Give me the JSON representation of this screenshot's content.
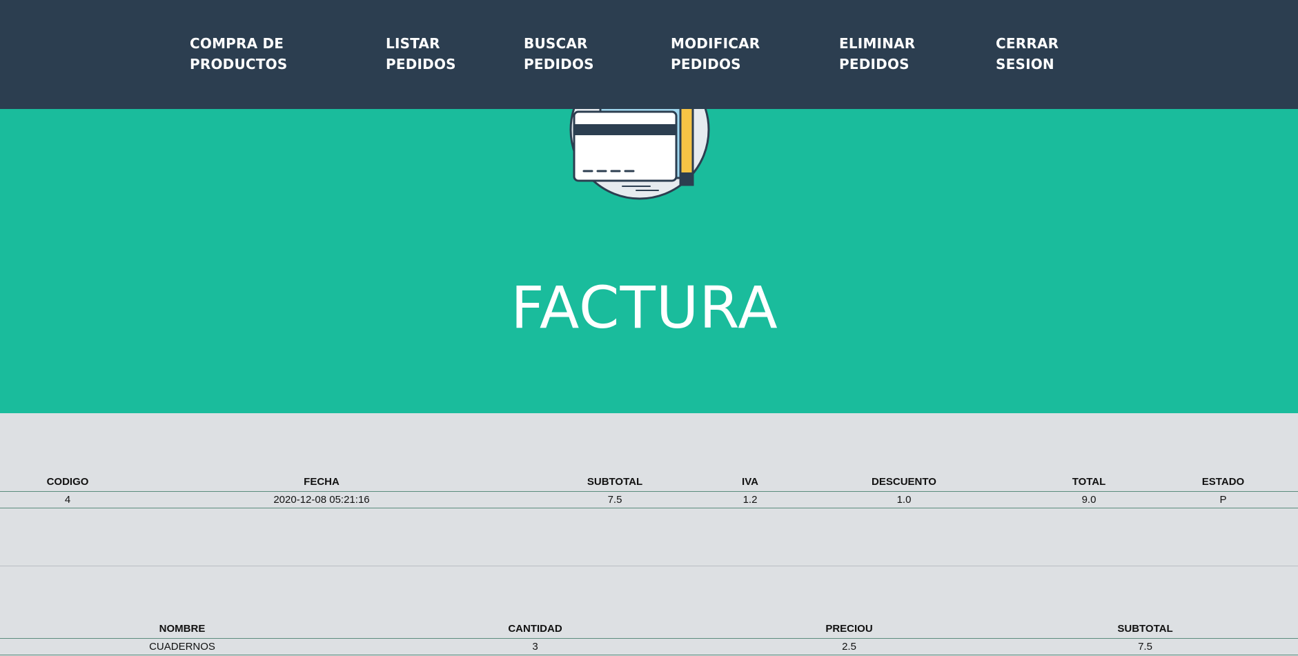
{
  "nav": {
    "items": [
      {
        "line1": "COMPRA DE",
        "line2": "PRODUCTOS"
      },
      {
        "line1": "LISTAR",
        "line2": "PEDIDOS"
      },
      {
        "line1": "BUSCAR",
        "line2": "PEDIDOS"
      },
      {
        "line1": "MODIFICAR",
        "line2": "PEDIDOS"
      },
      {
        "line1": "ELIMINAR",
        "line2": "PEDIDOS"
      },
      {
        "line1": "CERRAR",
        "line2": "SESION"
      }
    ]
  },
  "hero": {
    "icon": "credit-card-icon",
    "title": "FACTURA"
  },
  "order_table": {
    "headers": [
      "CODIGO",
      "FECHA",
      "SUBTOTAL",
      "IVA",
      "DESCUENTO",
      "TOTAL",
      "ESTADO"
    ],
    "rows": [
      [
        "4",
        "2020-12-08 05:21:16",
        "7.5",
        "1.2",
        "1.0",
        "9.0",
        "P"
      ]
    ]
  },
  "items_table": {
    "headers": [
      "NOMBRE",
      "CANTIDAD",
      "PRECIOU",
      "SUBTOTAL"
    ],
    "rows": [
      [
        "CUADERNOS",
        "3",
        "2.5",
        "7.5"
      ]
    ]
  },
  "colors": {
    "navbar": "#2c3e50",
    "hero": "#1abc9c",
    "page_bg": "#dde0e3"
  }
}
